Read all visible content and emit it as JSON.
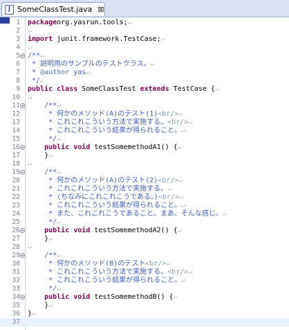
{
  "tab": {
    "icon": "java-file-icon",
    "icon_glyph": "J",
    "title": "SomeClassTest.java",
    "close_glyph": "⊠"
  },
  "editor": {
    "current_line": 37,
    "lines": [
      {
        "n": "1",
        "fold": false,
        "segs": [
          [
            "kw",
            "package"
          ],
          [
            "",
            "org.yasrun.tools;"
          ],
          [
            "ws",
            "↵"
          ]
        ]
      },
      {
        "n": "2",
        "fold": false,
        "segs": [
          [
            "ws",
            "↵"
          ]
        ]
      },
      {
        "n": "3",
        "fold": false,
        "segs": [
          [
            "kw",
            "import"
          ],
          [
            "",
            " junit.framework.TestCase;"
          ],
          [
            "ws",
            "↵"
          ]
        ]
      },
      {
        "n": "4",
        "fold": false,
        "segs": [
          [
            "ws",
            "↵"
          ]
        ]
      },
      {
        "n": "5",
        "fold": true,
        "segs": [
          [
            "jd",
            "/**"
          ],
          [
            "ws",
            "↵"
          ]
        ]
      },
      {
        "n": "6",
        "fold": false,
        "segs": [
          [
            "jd",
            " * 説明用のサンプルのテストクラス。"
          ],
          [
            "ws",
            "↵"
          ]
        ]
      },
      {
        "n": "7",
        "fold": false,
        "segs": [
          [
            "jd",
            " * "
          ],
          [
            "ann",
            "@author"
          ],
          [
            "jd",
            " yas"
          ],
          [
            "ws",
            "↵"
          ]
        ]
      },
      {
        "n": "8",
        "fold": false,
        "segs": [
          [
            "jd",
            " */"
          ],
          [
            "ws",
            "↵"
          ]
        ]
      },
      {
        "n": "9",
        "fold": false,
        "segs": [
          [
            "kw",
            "public class"
          ],
          [
            "",
            " SomeClassTest "
          ],
          [
            "kw",
            "extends"
          ],
          [
            "",
            " TestCase {"
          ],
          [
            "ws",
            "↵"
          ]
        ]
      },
      {
        "n": "10",
        "fold": false,
        "segs": [
          [
            "ws",
            "↵"
          ]
        ]
      },
      {
        "n": "11",
        "fold": true,
        "segs": [
          [
            "ws",
            "    "
          ],
          [
            "jd",
            "/**"
          ],
          [
            "ws",
            "↵"
          ]
        ]
      },
      {
        "n": "12",
        "fold": false,
        "segs": [
          [
            "jd",
            "     * 何かのメソッド(A)のテスト(1)"
          ],
          [
            "tag",
            "<br/>"
          ],
          [
            "ws",
            "↵"
          ]
        ]
      },
      {
        "n": "13",
        "fold": false,
        "segs": [
          [
            "jd",
            "     * これこれこういう方法で実施する。"
          ],
          [
            "tag",
            "<br/>"
          ],
          [
            "ws",
            "↵"
          ]
        ]
      },
      {
        "n": "14",
        "fold": false,
        "segs": [
          [
            "jd",
            "     * これこれこういう結果が得られること。"
          ],
          [
            "ws",
            "↵"
          ]
        ]
      },
      {
        "n": "15",
        "fold": false,
        "segs": [
          [
            "jd",
            "     */"
          ],
          [
            "ws",
            "↵"
          ]
        ]
      },
      {
        "n": "16",
        "fold": true,
        "segs": [
          [
            "ws",
            "    "
          ],
          [
            "kw",
            "public void"
          ],
          [
            "",
            " testSomemethodA1() {"
          ],
          [
            "ws",
            "↵"
          ]
        ]
      },
      {
        "n": "17",
        "fold": false,
        "segs": [
          [
            "ws",
            "    "
          ],
          [
            "",
            "}"
          ],
          [
            "ws",
            "↵"
          ]
        ]
      },
      {
        "n": "18",
        "fold": false,
        "segs": [
          [
            "ws",
            "↵"
          ]
        ]
      },
      {
        "n": "19",
        "fold": true,
        "segs": [
          [
            "ws",
            "    "
          ],
          [
            "jd",
            "/**"
          ],
          [
            "ws",
            "↵"
          ]
        ]
      },
      {
        "n": "20",
        "fold": false,
        "segs": [
          [
            "jd",
            "     * 何かのメソッド(A)のテスト(2)"
          ],
          [
            "tag",
            "<br/>"
          ],
          [
            "ws",
            "↵"
          ]
        ]
      },
      {
        "n": "21",
        "fold": false,
        "segs": [
          [
            "jd",
            "     * これこれこういう方法で実施する。"
          ],
          [
            "ws",
            "↵"
          ]
        ]
      },
      {
        "n": "22",
        "fold": false,
        "segs": [
          [
            "jd",
            "     * (ちなみにこれこれこうである。)"
          ],
          [
            "tag",
            "<br/>"
          ],
          [
            "ws",
            "↵"
          ]
        ]
      },
      {
        "n": "23",
        "fold": false,
        "segs": [
          [
            "jd",
            "     * これこれこういう結果が得られること。"
          ],
          [
            "ws",
            "↵"
          ]
        ]
      },
      {
        "n": "24",
        "fold": false,
        "segs": [
          [
            "jd",
            "     * また、これこれこうであること。まあ、そんな感じ。"
          ],
          [
            "ws",
            "↵"
          ]
        ]
      },
      {
        "n": "25",
        "fold": false,
        "segs": [
          [
            "jd",
            "     */"
          ],
          [
            "ws",
            "↵"
          ]
        ]
      },
      {
        "n": "26",
        "fold": true,
        "segs": [
          [
            "ws",
            "    "
          ],
          [
            "kw",
            "public void"
          ],
          [
            "",
            " testSomemethodA2() {"
          ],
          [
            "ws",
            "↵"
          ]
        ]
      },
      {
        "n": "27",
        "fold": false,
        "segs": [
          [
            "ws",
            "    "
          ],
          [
            "",
            "}"
          ],
          [
            "ws",
            "↵"
          ]
        ]
      },
      {
        "n": "28",
        "fold": false,
        "segs": [
          [
            "ws",
            "↵"
          ]
        ]
      },
      {
        "n": "29",
        "fold": true,
        "segs": [
          [
            "ws",
            "    "
          ],
          [
            "jd",
            "/**"
          ],
          [
            "ws",
            "↵"
          ]
        ]
      },
      {
        "n": "30",
        "fold": false,
        "segs": [
          [
            "jd",
            "     * 何かのメソッド(B)のテスト"
          ],
          [
            "tag",
            "<br/>"
          ],
          [
            "ws",
            "↵"
          ]
        ]
      },
      {
        "n": "31",
        "fold": false,
        "segs": [
          [
            "jd",
            "     * これこれこういう方法で実施する。"
          ],
          [
            "tag",
            "<br/>"
          ],
          [
            "ws",
            "↵"
          ]
        ]
      },
      {
        "n": "32",
        "fold": false,
        "segs": [
          [
            "jd",
            "     * これこれこういう結果が得られること。"
          ],
          [
            "ws",
            "↵"
          ]
        ]
      },
      {
        "n": "33",
        "fold": false,
        "segs": [
          [
            "jd",
            "     */"
          ],
          [
            "ws",
            "↵"
          ]
        ]
      },
      {
        "n": "34",
        "fold": true,
        "segs": [
          [
            "ws",
            "    "
          ],
          [
            "kw",
            "public void"
          ],
          [
            "",
            " testSomemethodB() {"
          ],
          [
            "ws",
            "↵"
          ]
        ]
      },
      {
        "n": "35",
        "fold": false,
        "segs": [
          [
            "ws",
            "    "
          ],
          [
            "",
            "}"
          ],
          [
            "ws",
            "↵"
          ]
        ]
      },
      {
        "n": "36",
        "fold": false,
        "segs": [
          [
            "",
            "}"
          ],
          [
            "ws",
            "↵"
          ]
        ]
      },
      {
        "n": "37",
        "fold": false,
        "segs": []
      }
    ]
  }
}
